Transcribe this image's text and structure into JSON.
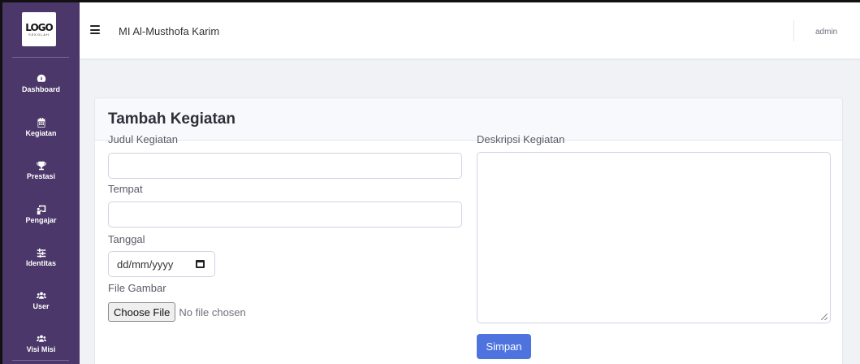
{
  "sidebar": {
    "logo": {
      "main": "LOGO",
      "sub": "SEKOLAH"
    },
    "items": [
      {
        "label": "Dashboard",
        "icon": "dashboard-icon"
      },
      {
        "label": "Kegiatan",
        "icon": "calendar-icon"
      },
      {
        "label": "Prestasi",
        "icon": "trophy-icon"
      },
      {
        "label": "Pengajar",
        "icon": "chalkboard-teacher-icon"
      },
      {
        "label": "Identitas",
        "icon": "sliders-icon"
      },
      {
        "label": "User",
        "icon": "users-icon"
      },
      {
        "label": "Visi Misi",
        "icon": "users-icon"
      }
    ],
    "color": "#4b3769"
  },
  "topbar": {
    "title": "MI Al-Musthofa Karim",
    "user": "admin"
  },
  "form": {
    "heading": "Tambah Kegiatan",
    "judul_label": "Judul Kegiatan",
    "judul_value": "",
    "tempat_label": "Tempat",
    "tempat_value": "",
    "tanggal_label": "Tanggal",
    "tanggal_placeholder": "dd/mm/yyyy",
    "file_label": "File Gambar",
    "file_button": "Choose File",
    "file_status": "No file chosen",
    "deskripsi_label": "Deskripsi Kegiatan",
    "deskripsi_value": "",
    "submit_label": "Simpan"
  },
  "colors": {
    "primary": "#4e73df",
    "background": "#f1f2f6"
  }
}
